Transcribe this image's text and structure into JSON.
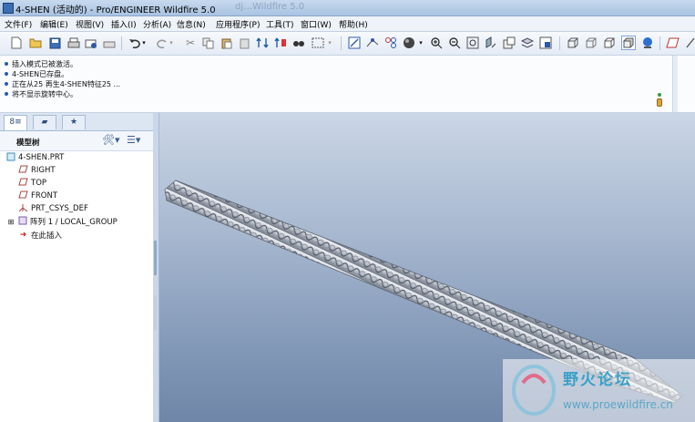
{
  "window": {
    "title": "4-SHEN (活动的) - Pro/ENGINEER Wildfire 5.0",
    "ghost_text": "dj…Wildfire 5.0"
  },
  "menu": [
    "文件(F)",
    "编辑(E)",
    "视图(V)",
    "插入(I)",
    "分析(A)",
    "信息(N)",
    "应用程序(P)",
    "工具(T)",
    "窗口(W)",
    "帮助(H)"
  ],
  "messages": [
    "插入模式已被激活。",
    "4-SHEN已存盘。",
    "正在从25 再生4-SHEN特征25 ...",
    "将不显示旋转中心。"
  ],
  "model_tree": {
    "header": "模型树",
    "items": [
      {
        "label": "4-SHEN.PRT",
        "icon": "part-icon"
      },
      {
        "label": "RIGHT",
        "icon": "datum-plane-icon"
      },
      {
        "label": "TOP",
        "icon": "datum-plane-icon"
      },
      {
        "label": "FRONT",
        "icon": "datum-plane-icon"
      },
      {
        "label": "PRT_CSYS_DEF",
        "icon": "csys-icon"
      },
      {
        "label": "阵列 1 / LOCAL_GROUP",
        "icon": "pattern-icon"
      },
      {
        "label": "在此插入",
        "icon": "insert-here-icon"
      }
    ]
  },
  "watermark": {
    "title": "野火论坛",
    "url": "www.proewildfire.cn"
  },
  "colors": {
    "accent": "#2b5aa8",
    "rope": "#c9ced6",
    "viewport_top": "#cbd6e6",
    "viewport_bottom": "#6f86a8"
  }
}
